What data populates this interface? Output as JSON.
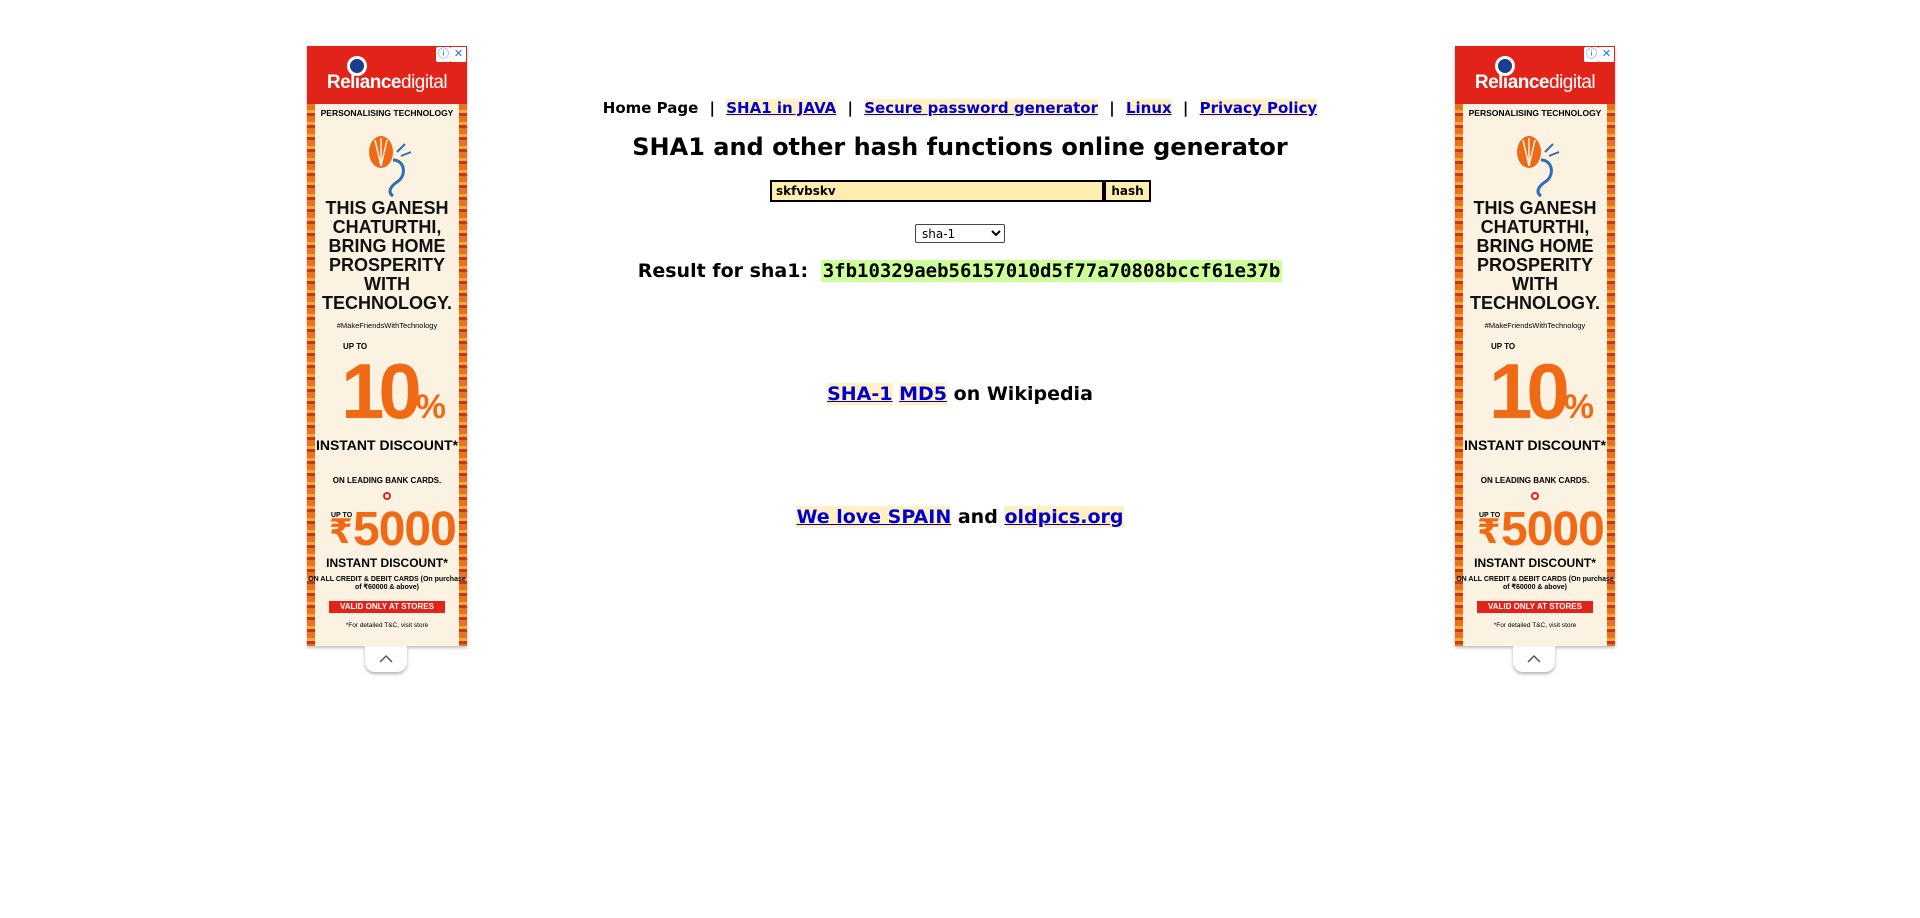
{
  "nav": {
    "home": "Home Page",
    "sep": "|",
    "links": [
      "SHA1 in JAVA",
      "Secure password generator",
      "Linux",
      "Privacy Policy"
    ]
  },
  "title": "SHA1 and other hash functions online generator",
  "form": {
    "input_value": "skfvbskv",
    "button_label": "hash",
    "algorithm_selected": "sha-1"
  },
  "result": {
    "label": "Result for sha1:",
    "hash": "3fb10329aeb56157010d5f77a70808bccf61e37b"
  },
  "wiki": {
    "link1": "SHA-1",
    "link2": "MD5",
    "suffix": "on Wikipedia"
  },
  "footer": {
    "link1": "We love SPAIN",
    "conj": "and",
    "link2": "oldpics.org"
  },
  "ad": {
    "brand_main": "Reliance",
    "brand_thin": "digital",
    "info_icon": "info-icon",
    "close_icon": "close-icon",
    "tagline": "PERSONALISING TECHNOLOGY",
    "headline": "THIS GANESH CHATURTHI, BRING HOME PROSPERITY WITH TECHNOLOGY.",
    "hashtag": "#MakeFriendsWithTechnology",
    "upto": "UP TO",
    "percent_number": "10",
    "percent_sign": "%",
    "instant_discount": "INSTANT DISCOUNT*",
    "banks": "ON LEADING BANK CARDS.",
    "upto2": "UP TO",
    "rupee": "₹",
    "amount": "5000",
    "instant_discount2": "INSTANT DISCOUNT*",
    "cards": "ON ALL CREDIT & DEBIT CARDS (On purchase of ₹60000 & above)",
    "valid": "VALID ONLY AT STORES",
    "tnc": "*For detailed T&C, visit store",
    "colors": {
      "brand_red": "#e2231a",
      "accent_orange": "#f06a16"
    }
  },
  "colors": {
    "link": "#0000cc",
    "link_bg": "#fff1c4",
    "input_bg": "#ffeeb0",
    "hash_bg": "#ccff99"
  }
}
